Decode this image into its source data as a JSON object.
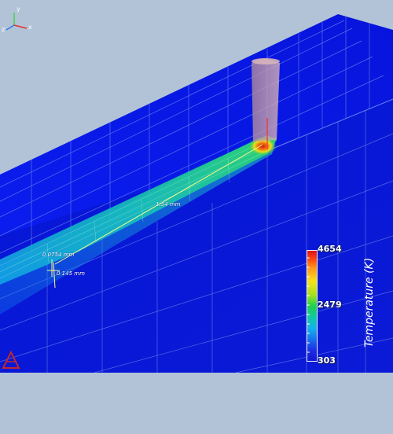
{
  "axes_triad": {
    "x_label": "x",
    "y_label": "y",
    "z_label": "z"
  },
  "measurements": [
    {
      "label": "1.54  mm"
    },
    {
      "label": "0.0754 mm"
    },
    {
      "label": "0.145  mm"
    }
  ],
  "legend": {
    "max": "4654",
    "mid": "2479",
    "min": "303",
    "title": "Temperature (K)"
  },
  "colors": {
    "background": "#b2c3d7",
    "block_blue": "#0a14e6",
    "mesh_line": "#8fa4e6",
    "hot_core": "#e01010",
    "track_green": "#27d84a",
    "track_cyan": "#18c8d8",
    "laser_beam": "#c69aa3"
  },
  "icons": [
    "axes-triad-icon",
    "app-logo-icon"
  ]
}
